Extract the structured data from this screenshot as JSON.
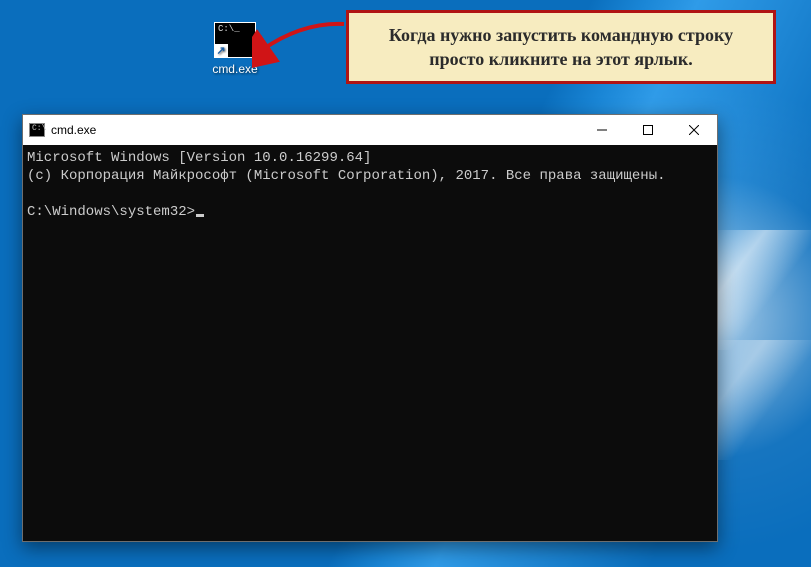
{
  "desktop": {
    "shortcut": {
      "label": "cmd.exe",
      "icon_text": "C:\\_"
    }
  },
  "annotation": {
    "callout_text": "Когда нужно запустить командную строку просто кликните на этот ярлык."
  },
  "cmd_window": {
    "title": "cmd.exe",
    "icon_text": "C:\\",
    "terminal": {
      "line1": "Microsoft Windows [Version 10.0.16299.64]",
      "line2": "(c) Корпорация Майкрософт (Microsoft Corporation), 2017. Все права защищены.",
      "blank": "",
      "prompt": "C:\\Windows\\system32>"
    },
    "buttons": {
      "minimize_label": "Minimize",
      "maximize_label": "Maximize",
      "close_label": "Close"
    }
  }
}
